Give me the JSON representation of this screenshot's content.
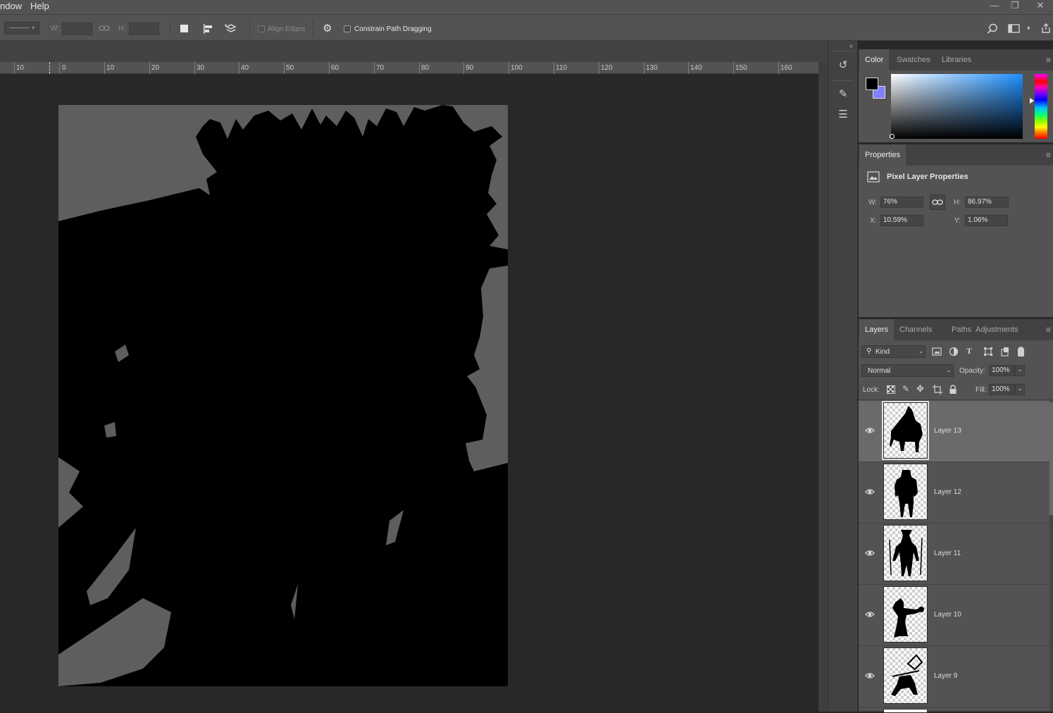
{
  "menubar": {
    "items": [
      "ndow",
      "Help"
    ],
    "controls": {
      "minimize": "—",
      "restore": "❐",
      "close": "✕"
    }
  },
  "options": {
    "w_label": "W:",
    "w_value": "",
    "h_label": "H:",
    "h_value": "",
    "align_edges_label": "Align Edges",
    "constrain_label": "Constrain Path Dragging",
    "constrain_checked": false
  },
  "ruler": {
    "ticks": [
      "10",
      "0",
      "10",
      "20",
      "30",
      "40",
      "50",
      "60",
      "70",
      "80",
      "90",
      "100",
      "110",
      "120",
      "130",
      "140",
      "150",
      "160"
    ]
  },
  "color_panel": {
    "tabs": [
      "Color",
      "Swatches",
      "Libraries"
    ],
    "active_tab": "Color",
    "foreground": "#000000",
    "background": "#7f7fff",
    "hue_color": "#1e90ff"
  },
  "properties_panel": {
    "tab": "Properties",
    "heading": "Pixel Layer Properties",
    "w_label": "W:",
    "w_value": "76%",
    "h_label": "H:",
    "h_value": "86.97%",
    "x_label": "X:",
    "x_value": "10.59%",
    "y_label": "Y:",
    "y_value": "1.06%"
  },
  "layers_panel": {
    "tabs": [
      "Layers",
      "Channels",
      "Paths",
      "Adjustments"
    ],
    "active_tab": "Layers",
    "filter_kind": "Kind",
    "blend_mode": "Normal",
    "opacity_label": "Opacity:",
    "opacity_value": "100%",
    "lock_label": "Lock:",
    "fill_label": "Fill:",
    "fill_value": "100%",
    "layers": [
      {
        "name": "Layer 13",
        "selected": true,
        "visible": true
      },
      {
        "name": "Layer 12",
        "selected": false,
        "visible": true
      },
      {
        "name": "Layer 11",
        "selected": false,
        "visible": true
      },
      {
        "name": "Layer 10",
        "selected": false,
        "visible": true
      },
      {
        "name": "Layer 9",
        "selected": false,
        "visible": true
      }
    ]
  }
}
